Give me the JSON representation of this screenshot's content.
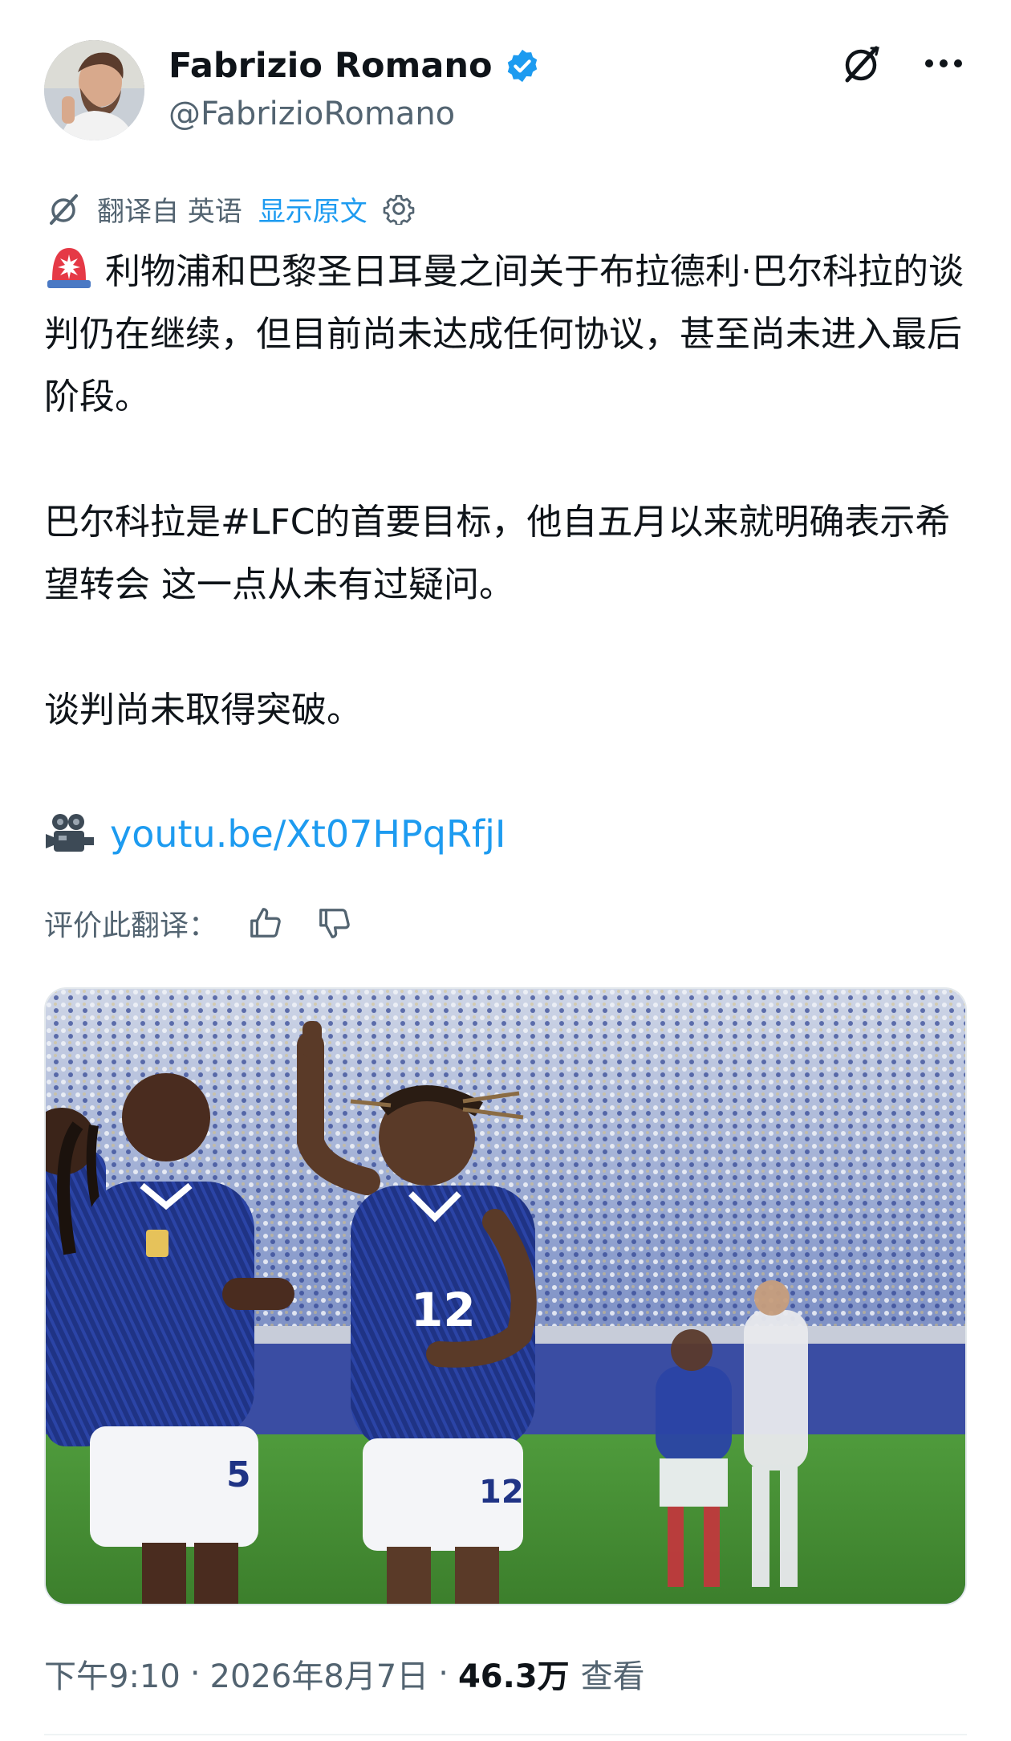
{
  "author": {
    "display_name": "Fabrizio Romano",
    "handle": "@FabrizioRomano",
    "verified_color": "#1d9bf0"
  },
  "header_actions": {
    "grok_icon": "slash-circle-icon",
    "more_icon": "more-dots-icon"
  },
  "translation": {
    "translated_from": "翻译自 英语",
    "show_original": "显示原文",
    "settings_icon": "gear-icon"
  },
  "tweet": {
    "paragraph_1": "利物浦和巴黎圣日耳曼之间关于布拉德利·巴尔科拉的谈判仍在继续，但目前尚未达成任何协议，甚至尚未进入最后阶段。",
    "paragraph_2": "巴尔科拉是#LFC的首要目标，他自五月以来就明确表示希望转会 这一点从未有过疑问。",
    "paragraph_3": "谈判尚未取得突破。",
    "link": "youtu.be/Xt07HPqRfjI",
    "siren_icon": "siren-emoji",
    "camera_icon": "movie-camera-emoji"
  },
  "rating": {
    "label": "评价此翻译：",
    "like_icon": "thumbs-up-icon",
    "dislike_icon": "thumbs-down-icon"
  },
  "media": {
    "alt": "photo",
    "jersey_number": "12"
  },
  "meta": {
    "time": "下午9:10",
    "date": "2026年8月7日",
    "separator": "·",
    "views_count": "46.3万",
    "views_label": "查看"
  },
  "colors": {
    "accent": "#1d9bf0",
    "secondary_text": "#536471",
    "primary_text": "#0f1419"
  }
}
